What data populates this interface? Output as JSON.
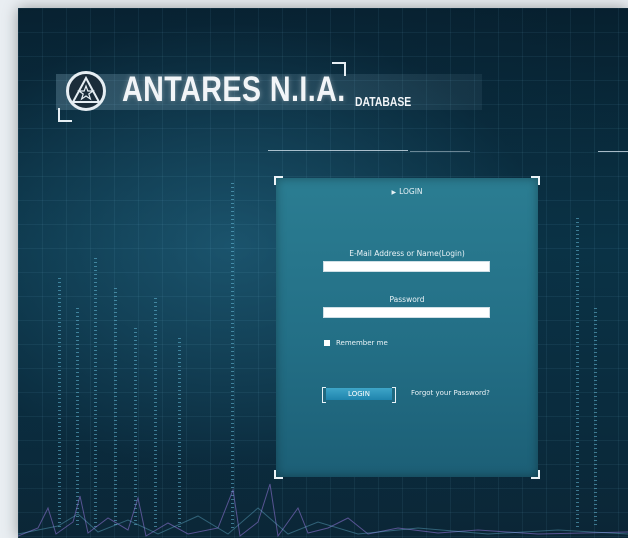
{
  "header": {
    "brand": "ANTARES N.I.A.",
    "subbrand": "DATABASE",
    "logo_icon": "star-emblem-icon"
  },
  "login_panel": {
    "title": "LOGIN",
    "email_label": "E-Mail Address or Name(Login)",
    "email_value": "",
    "password_label": "Password",
    "password_value": "",
    "remember_label": "Remember me",
    "login_button": "LOGIN",
    "forgot_link": "Forgot your Password?"
  },
  "colors": {
    "background": "#0a3346",
    "panel": "#2b7d92",
    "accent": "#3ea5c8"
  }
}
